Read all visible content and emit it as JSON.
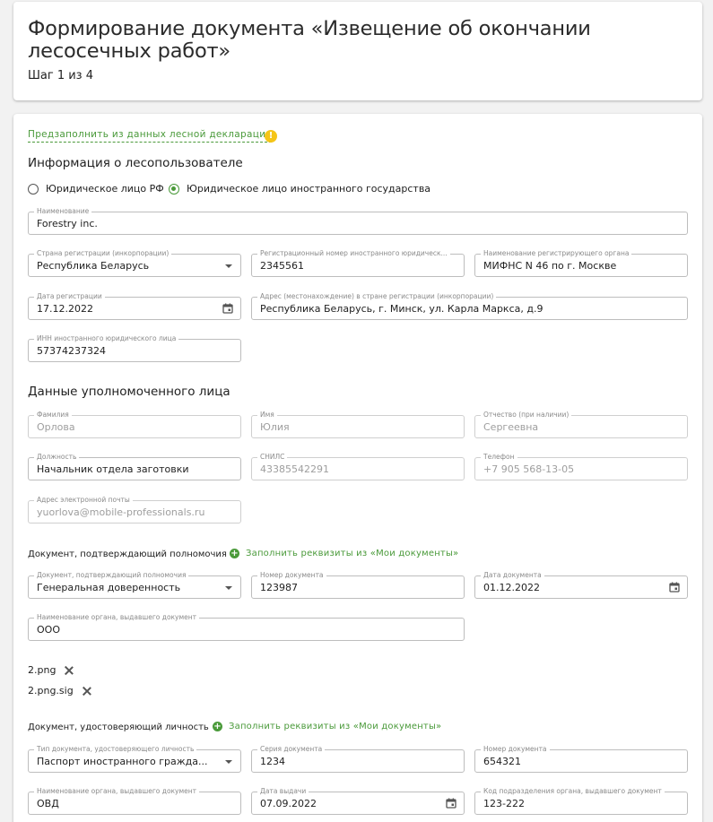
{
  "header": {
    "title": "Формирование документа «Извещение об окончании лесосечных работ»",
    "step": "Шаг 1 из 4"
  },
  "prefill_link": "Предзаполнить из данных лесной декларации",
  "user_section": {
    "title": "Информация о лесопользователе",
    "radio_ru": "Юридическое лицо РФ",
    "radio_foreign": "Юридическое лицо иностранного государства",
    "name": {
      "label": "Наименование",
      "value": "Forestry inc."
    },
    "country": {
      "label": "Страна регистрации (инкорпорации)",
      "value": "Республика Беларусь"
    },
    "reg_number": {
      "label": "Регистрационный номер иностранного юридическ...",
      "value": "2345561"
    },
    "reg_organ": {
      "label": "Наименование регистрирующего органа",
      "value": "МИФНС N 46 по г. Москве"
    },
    "reg_date": {
      "label": "Дата регистрации",
      "value": "17.12.2022"
    },
    "address": {
      "label": "Адрес (местонахождение) в стране регистрации (инкорпорации)",
      "value": "Республика Беларусь, г. Минск, ул. Карла Маркса, д.9"
    },
    "inn": {
      "label": "ИНН иностранного юридического лица",
      "value": "57374237324"
    }
  },
  "person_section": {
    "title": "Данные уполномоченного лица",
    "surname": {
      "label": "Фамилия",
      "value": "Орлова"
    },
    "first_name": {
      "label": "Имя",
      "value": "Юлия"
    },
    "patronymic": {
      "label": "Отчество (при наличии)",
      "value": "Сергеевна"
    },
    "position": {
      "label": "Должность",
      "value": "Начальник отдела заготовки"
    },
    "snils": {
      "label": "СНИЛС",
      "value": "43385542291"
    },
    "phone": {
      "label": "Телефон",
      "value": "+7 905 568-13-05"
    },
    "email": {
      "label": "Адрес электронной почты",
      "value": "yuorlova@mobile-professionals.ru"
    }
  },
  "authority_doc": {
    "title": "Документ, подтверждающий полномочия",
    "fill_link": "Заполнить реквизиты из «Мои документы»",
    "doc_type": {
      "label": "Документ, подтверждающий полномочия",
      "value": "Генеральная доверенность"
    },
    "doc_number": {
      "label": "Номер документа",
      "value": "123987"
    },
    "doc_date": {
      "label": "Дата документа",
      "value": "01.12.2022"
    },
    "issuer": {
      "label": "Наименование органа, выдавшего документ",
      "value": "ООО"
    },
    "files": [
      "2.png",
      "2.png.sig"
    ]
  },
  "identity_doc": {
    "title": "Документ, удостоверяющий личность",
    "fill_link": "Заполнить реквизиты из «Мои документы»",
    "doc_type": {
      "label": "Тип документа, удостоверяющего личность",
      "value": "Паспорт иностранного гражда..."
    },
    "series": {
      "label": "Серия документа",
      "value": "1234"
    },
    "number": {
      "label": "Номер документа",
      "value": "654321"
    },
    "issuer": {
      "label": "Наименование органа, выдавшего документ",
      "value": "ОВД"
    },
    "issue_date": {
      "label": "Дата выдачи",
      "value": "07.09.2022"
    },
    "division_code": {
      "label": "Код подразделения органа, выдавшего документ",
      "value": "123-222"
    }
  },
  "colors": {
    "accent": "#4a9a3a",
    "warning": "#f5c518"
  }
}
